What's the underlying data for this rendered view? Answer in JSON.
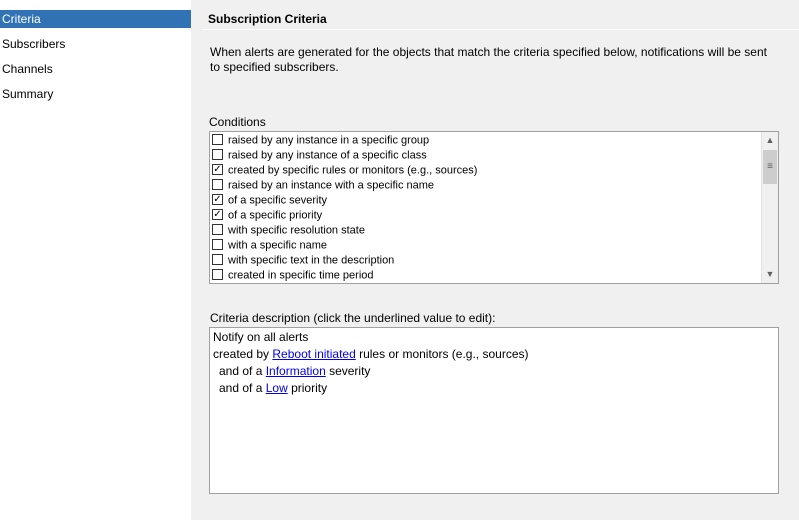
{
  "nav": {
    "items": [
      {
        "label": "Criteria"
      },
      {
        "label": "Subscribers"
      },
      {
        "label": "Channels"
      },
      {
        "label": "Summary"
      }
    ]
  },
  "main": {
    "title": "Subscription Criteria",
    "intro": "When alerts are generated for the objects that match the criteria specified below, notifications will be sent to specified subscribers.",
    "conditions_label": "Conditions",
    "conditions": [
      {
        "label": "raised by any instance in a specific group",
        "checked": false
      },
      {
        "label": "raised by any instance of a specific class",
        "checked": false
      },
      {
        "label": "created by specific rules or monitors (e.g., sources)",
        "checked": true
      },
      {
        "label": "raised by an instance with a specific name",
        "checked": false
      },
      {
        "label": "of a specific severity",
        "checked": true
      },
      {
        "label": "of a specific priority",
        "checked": true
      },
      {
        "label": "with specific resolution state",
        "checked": false
      },
      {
        "label": "with a specific name",
        "checked": false
      },
      {
        "label": "with specific text in the description",
        "checked": false
      },
      {
        "label": "created in specific time period",
        "checked": false
      }
    ],
    "criteria_label": "Criteria description (click the underlined value to edit):",
    "criteria": {
      "line1": "Notify on all alerts",
      "line2_pre": "created by ",
      "line2_link": "Reboot initiated",
      "line2_post": " rules or monitors (e.g., sources)",
      "line3_pre": "and of a ",
      "line3_link": "Information",
      "line3_post": " severity",
      "line4_pre": "and of a ",
      "line4_link": "Low",
      "line4_post": " priority"
    }
  },
  "icons": {
    "scroll_up": "▲",
    "scroll_down": "▼",
    "grip": "≡",
    "check": "✓"
  }
}
